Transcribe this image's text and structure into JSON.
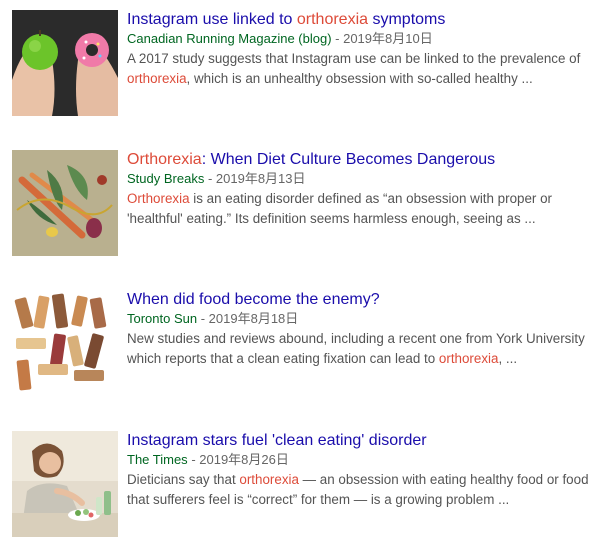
{
  "results": [
    {
      "title_hl_pre": "Instagram use linked to ",
      "title_hl": "orthorexia",
      "title_hl_post": " symptoms",
      "source": "Canadian Running Magazine (blog)",
      "date": "- 2019年8月10日",
      "snippet_pre": "A 2017 study suggests that Instagram use can be linked to the prevalence of ",
      "snippet_hl": "orthorexia",
      "snippet_post": ", which is an unhealthy obsession with so-called healthy ..."
    },
    {
      "title_hl": "Orthorexia",
      "title_hl_post": ": When Diet Culture Becomes Dangerous",
      "source": "Study Breaks",
      "date": "- 2019年8月13日",
      "snippet_hl": "Orthorexia",
      "snippet_post": " is an eating disorder defined as “an obsession with proper or 'healthful' eating.” Its definition seems harmless enough, seeing as ..."
    },
    {
      "title": "When did food become the enemy?",
      "source": "Toronto Sun",
      "date": "- 2019年8月18日",
      "snippet_pre": "New studies and reviews abound, including a recent one from York University which reports that a clean eating fixation can lead to ",
      "snippet_hl": "orthorexia",
      "snippet_post": ", ..."
    },
    {
      "title": "Instagram stars fuel 'clean eating' disorder",
      "source": "The Times",
      "date": "- 2019年8月26日",
      "snippet_pre": "Dieticians say that ",
      "snippet_hl": "orthorexia",
      "snippet_post": " — an obsession with eating healthy food or food that sufferers feel is “correct” for them — is a growing problem ..."
    }
  ],
  "colors": {
    "title": "#1a0dab",
    "highlight": "#dd4b39",
    "source": "#006621",
    "snippet": "#545454"
  }
}
